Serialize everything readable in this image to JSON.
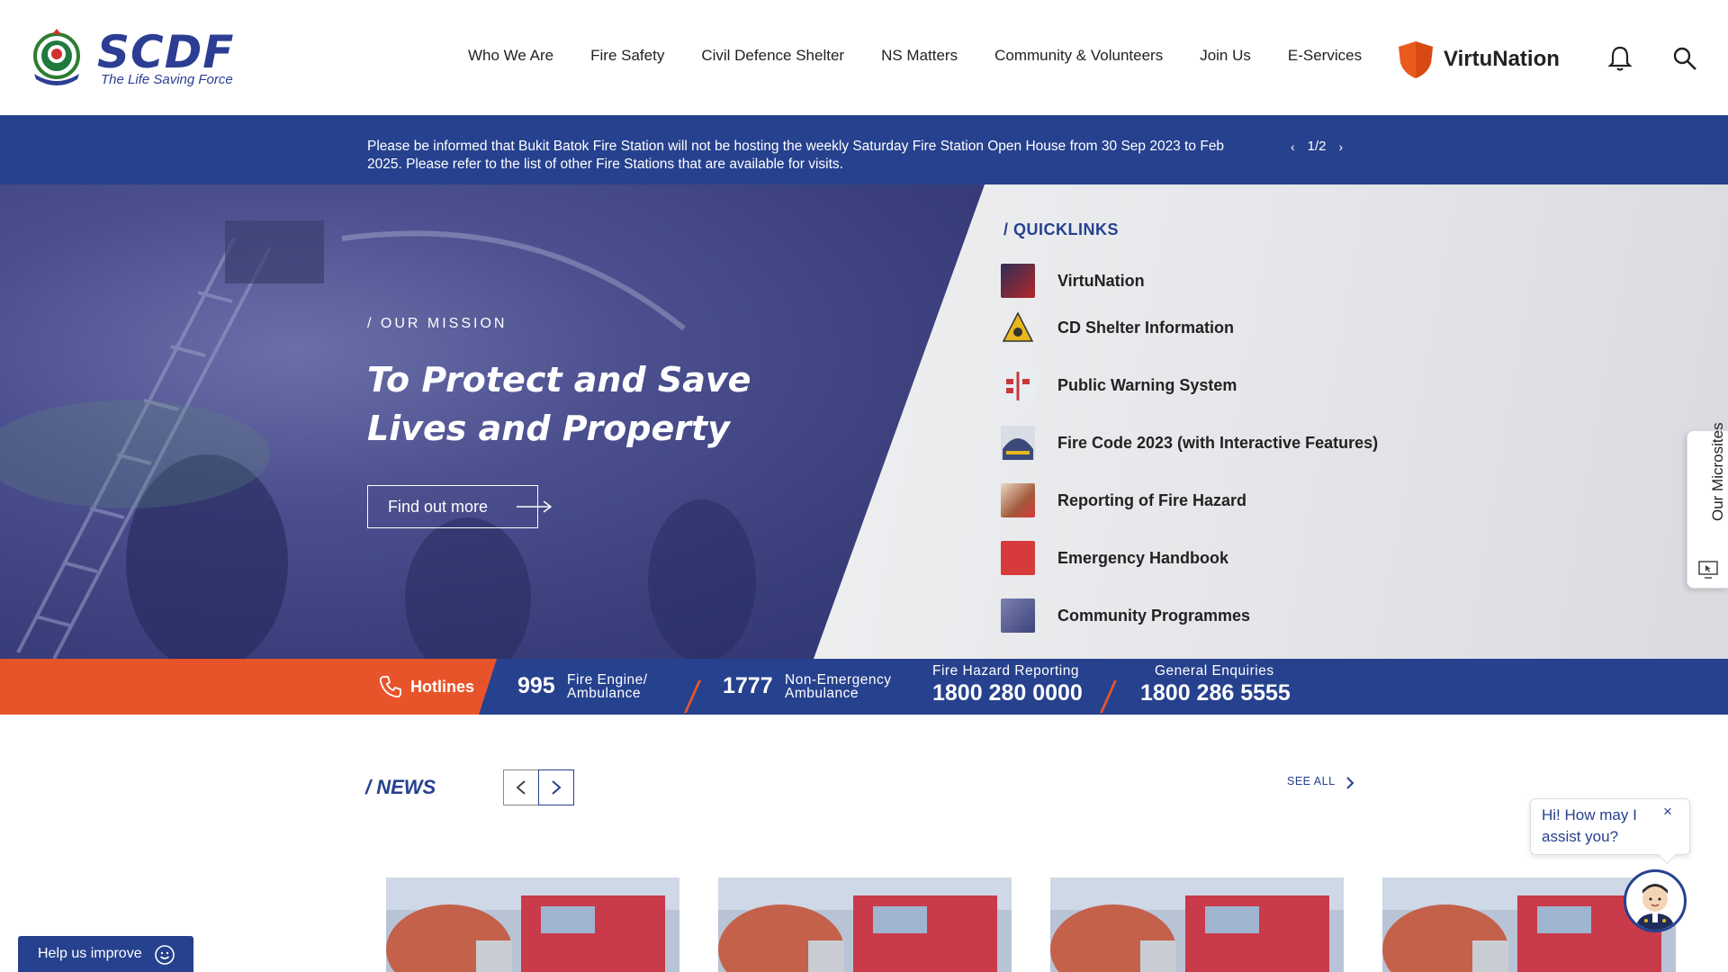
{
  "header": {
    "logo_text": "SCDF",
    "logo_tagline": "The Life Saving Force",
    "nav": [
      "Who We Are",
      "Fire Safety",
      "Civil Defence Shelter",
      "NS Matters",
      "Community & Volunteers",
      "Join Us",
      "E-Services"
    ],
    "virtunation_label": "VirtuNation"
  },
  "announcement": {
    "text": "Please be informed that Bukit Batok Fire Station will not be hosting the weekly Saturday Fire Station Open House from 30 Sep 2023 to Feb 2025. Please refer to the list of other Fire Stations that are available for visits.",
    "pager": "1/2"
  },
  "hero": {
    "kicker": "/ OUR MISSION",
    "title": "To Protect and Save Lives and Property",
    "button": "Find out more"
  },
  "quicklinks": {
    "title": "/ QUICKLINKS",
    "items": [
      {
        "label": "VirtuNation",
        "color": "#b5262b"
      },
      {
        "label": "CD Shelter Information",
        "color": "#e7b81e"
      },
      {
        "label": "Public Warning System",
        "color": "#c9383b"
      },
      {
        "label": "Fire Code 2023 (with Interactive Features)",
        "color": "#3b4a7a"
      },
      {
        "label": "Reporting of Fire Hazard",
        "color": "#a35a3b"
      },
      {
        "label": "Emergency Handbook",
        "color": "#d63a3a"
      },
      {
        "label": "Community Programmes",
        "color": "#3d4379"
      }
    ]
  },
  "hotlines": {
    "label": "Hotlines",
    "items": [
      {
        "number": "995",
        "desc_1": "Fire Engine/",
        "desc_2": "Ambulance"
      },
      {
        "number": "1777",
        "desc_1": "Non-Emergency",
        "desc_2": "Ambulance"
      },
      {
        "heading": "Fire Hazard Reporting",
        "number": "1800 280 0000"
      },
      {
        "heading": "General Enquiries",
        "number": "1800 286 5555"
      }
    ]
  },
  "news": {
    "title": "/  NEWS",
    "see_all": "SEE ALL"
  },
  "microsites": {
    "label": "Our Microsites"
  },
  "help": {
    "label": "Help us improve"
  },
  "chat": {
    "prompt": "Hi! How may I assist you?",
    "close": "×"
  },
  "colors": {
    "brand_blue": "#26418e",
    "accent_orange": "#e8542a"
  }
}
